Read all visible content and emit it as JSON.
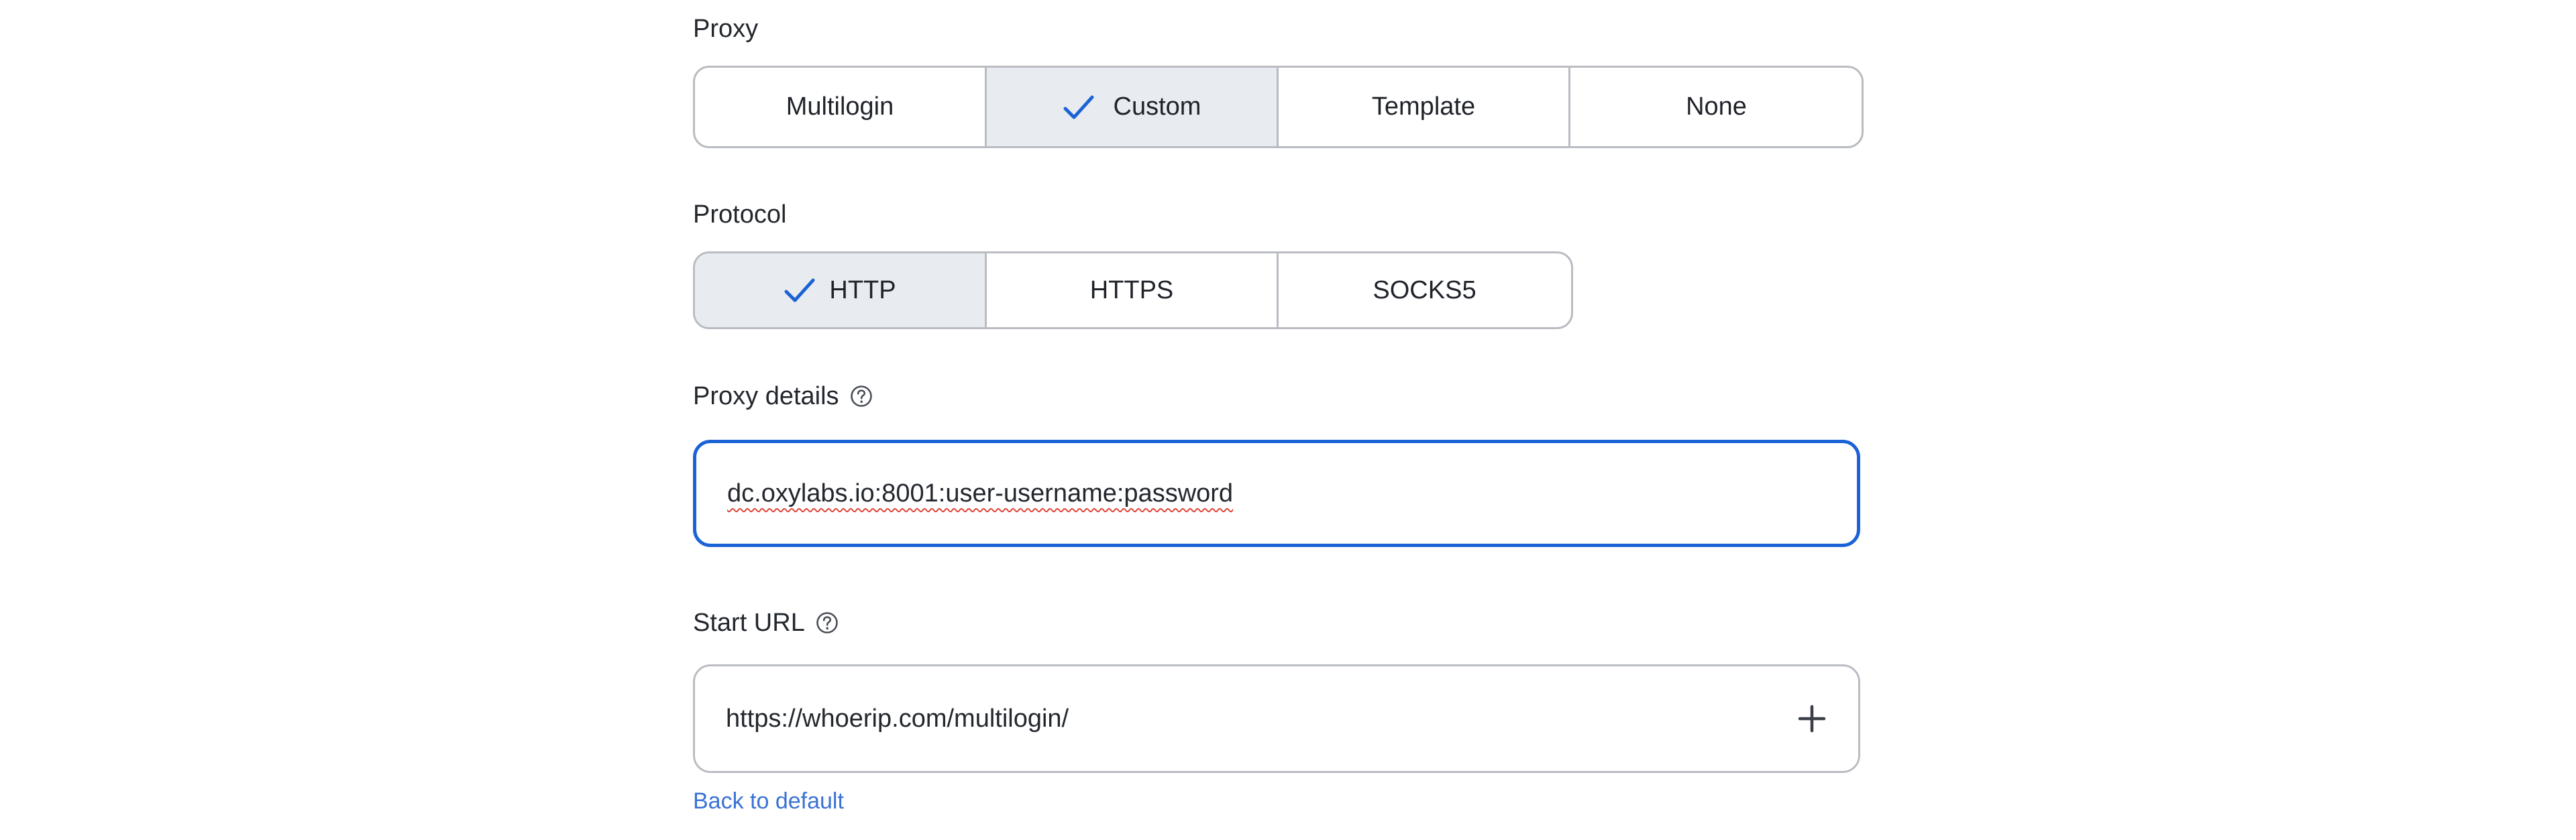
{
  "proxy": {
    "label": "Proxy",
    "options": [
      {
        "label": "Multilogin",
        "selected": false
      },
      {
        "label": "Custom",
        "selected": true
      },
      {
        "label": "Template",
        "selected": false
      },
      {
        "label": "None",
        "selected": false
      }
    ]
  },
  "protocol": {
    "label": "Protocol",
    "options": [
      {
        "label": "HTTP",
        "selected": true
      },
      {
        "label": "HTTPS",
        "selected": false
      },
      {
        "label": "SOCKS5",
        "selected": false
      }
    ]
  },
  "proxy_details": {
    "label": "Proxy details",
    "value": "dc.oxylabs.io:8001:user-username:password"
  },
  "start_url": {
    "label": "Start URL",
    "value": "https://whoerip.com/multilogin/"
  },
  "back_to_default": "Back to default",
  "colors": {
    "accent": "#1a62d6",
    "selected_bg": "#e8ebf0",
    "border": "#b9bcc2",
    "link": "#3a72d4"
  },
  "icons": [
    "check-icon",
    "help-icon",
    "plus-icon"
  ]
}
